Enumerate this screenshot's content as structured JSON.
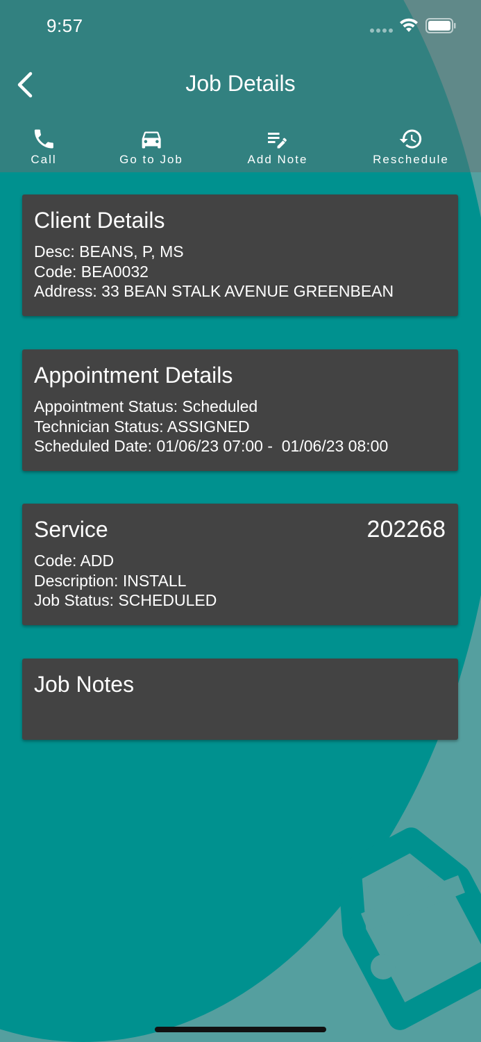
{
  "status_bar": {
    "time": "9:57"
  },
  "nav": {
    "title": "Job Details"
  },
  "actions": [
    {
      "label": "Call",
      "icon": "phone-icon"
    },
    {
      "label": "Go to Job",
      "icon": "car-icon"
    },
    {
      "label": "Add Note",
      "icon": "note-edit-icon"
    },
    {
      "label": "Reschedule",
      "icon": "history-icon"
    }
  ],
  "client": {
    "title": "Client Details",
    "desc": "Desc: BEANS, P, MS",
    "code": "Code: BEA0032",
    "address": "Address: 33 BEAN STALK AVENUE GREENBEAN"
  },
  "appointment": {
    "title": "Appointment Details",
    "status": "Appointment Status: Scheduled",
    "technician_status": "Technician Status: ASSIGNED",
    "scheduled_date": "Scheduled Date: 01/06/23 07:00 -  01/06/23 08:00"
  },
  "service": {
    "title": "Service",
    "number": "202268",
    "code": "Code: ADD",
    "description": "Description: INSTALL",
    "job_status": "Job Status: SCHEDULED"
  },
  "job_notes": {
    "title": "Job Notes"
  },
  "colors": {
    "teal_primary": "#00918f",
    "teal_light": "#559f9f",
    "card_background": "#434343",
    "header_overlay": "#6e6e6e"
  }
}
